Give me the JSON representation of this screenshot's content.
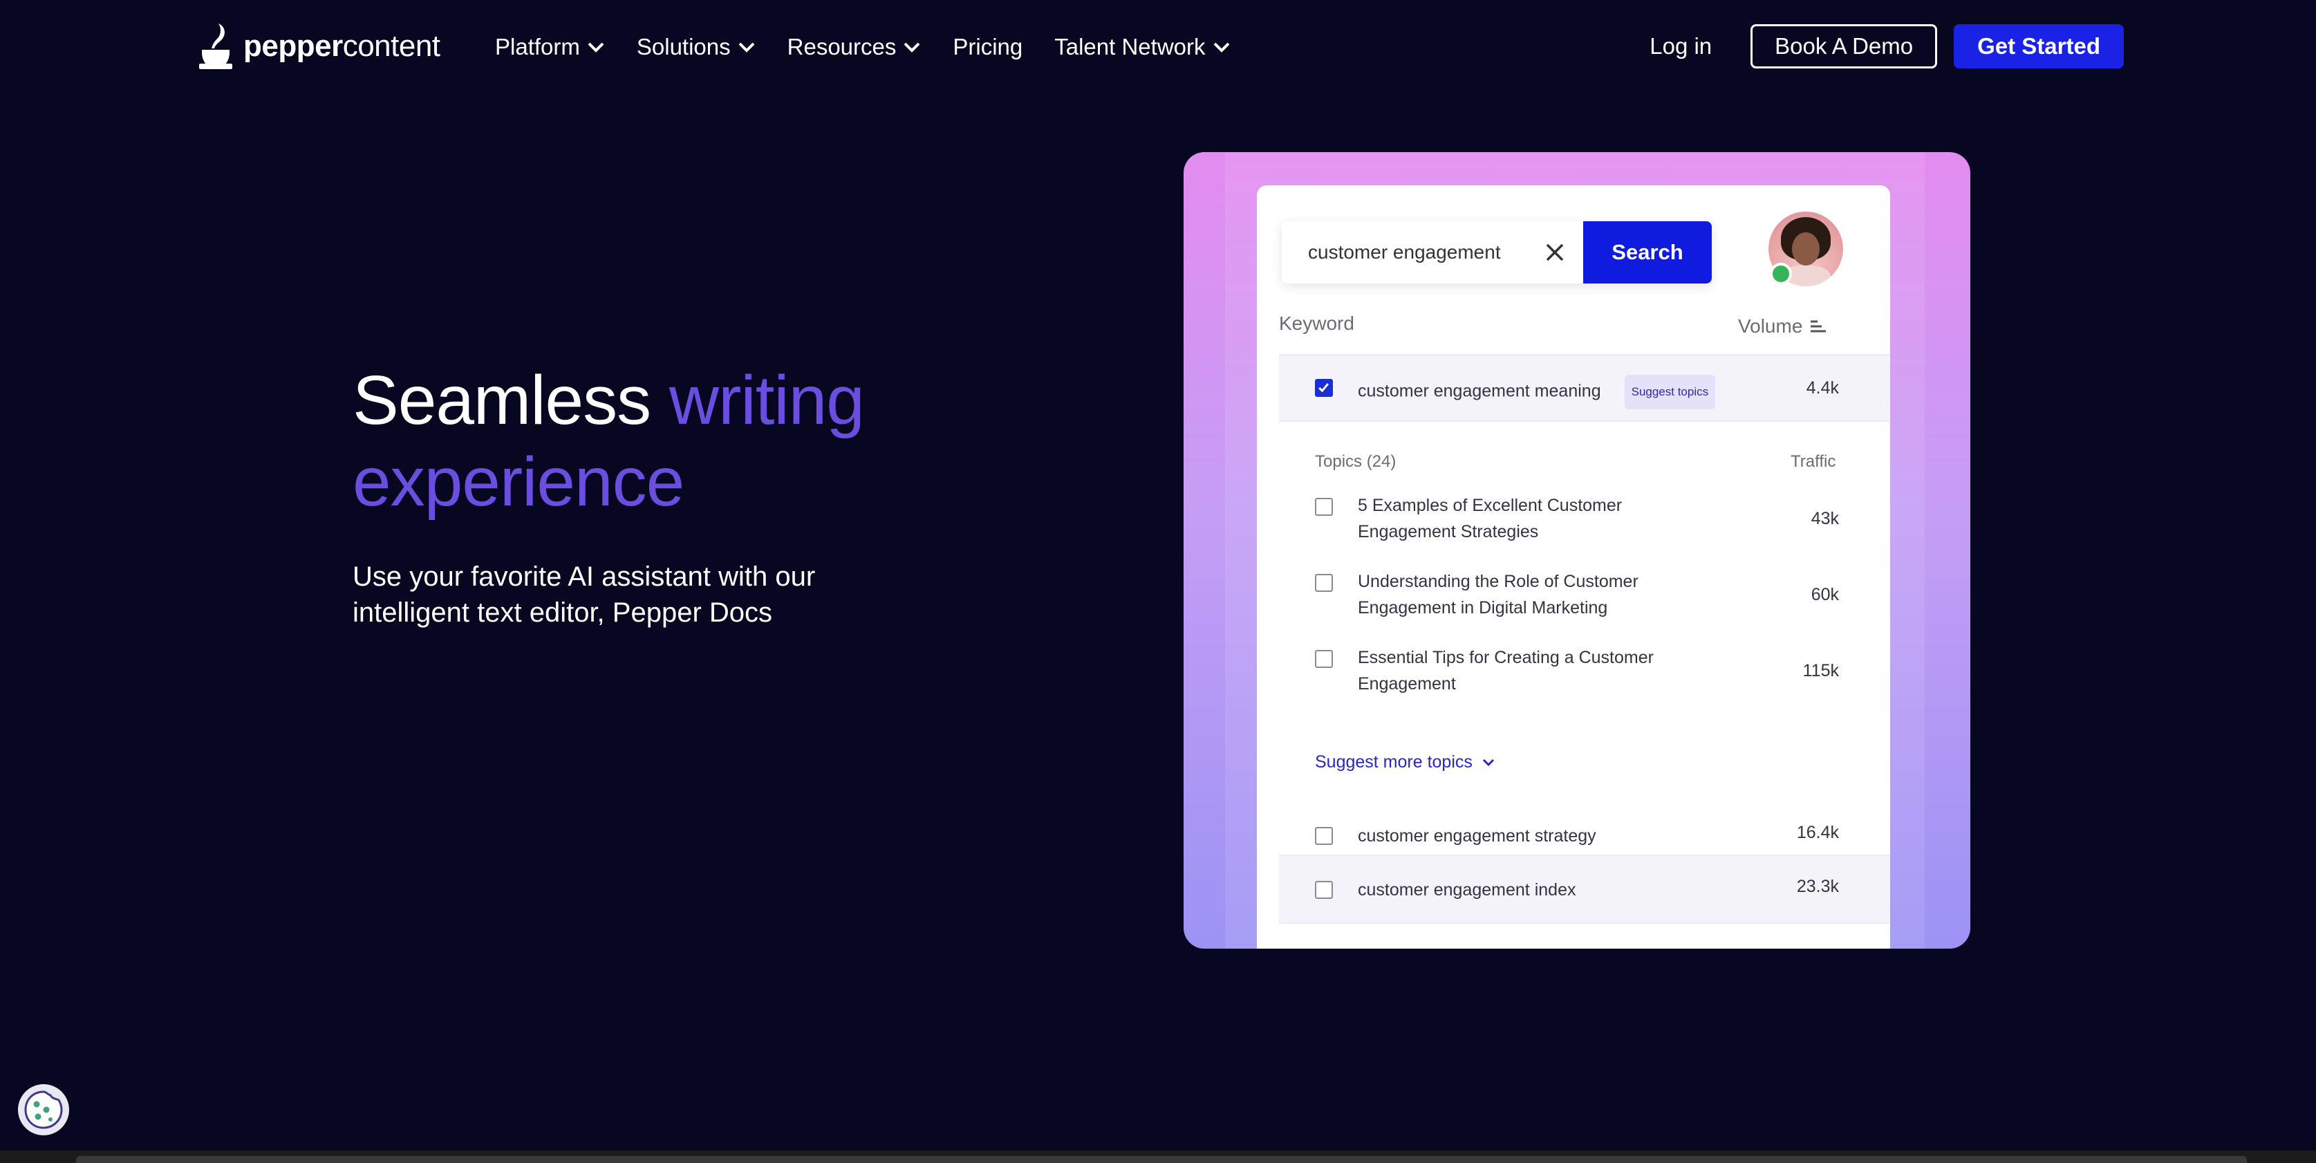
{
  "brand": {
    "name_bold": "pepper",
    "name_light": "content"
  },
  "nav": {
    "items": [
      {
        "label": "Platform",
        "dropdown": true
      },
      {
        "label": "Solutions",
        "dropdown": true
      },
      {
        "label": "Resources",
        "dropdown": true
      },
      {
        "label": "Pricing",
        "dropdown": false
      },
      {
        "label": "Talent Network",
        "dropdown": true
      }
    ],
    "login_label": "Log in",
    "demo_label": "Book A Demo",
    "start_label": "Get Started"
  },
  "hero": {
    "title_plain": "Seamless ",
    "title_accent_1": "writing",
    "title_accent_2": "experience",
    "subtitle": "Use your favorite AI assistant with our intelligent text editor, Pepper Docs"
  },
  "card": {
    "search": {
      "value": "customer engagement",
      "button_label": "Search"
    },
    "columns": {
      "keyword": "Keyword",
      "volume": "Volume"
    },
    "selected_keyword": {
      "label": "customer engagement meaning",
      "tag": "Suggest topics",
      "volume": "4.4k",
      "checked": true
    },
    "topics_header": {
      "title": "Topics (24)",
      "traffic": "Traffic"
    },
    "topics": [
      {
        "line1": "5 Examples of Excellent Customer",
        "line2": "Engagement Strategies",
        "traffic": "43k"
      },
      {
        "line1": "Understanding the Role of Customer",
        "line2": "Engagement in Digital Marketing",
        "traffic": "60k"
      },
      {
        "line1": "Essential Tips for Creating a Customer",
        "line2": "Engagement",
        "traffic": "115k"
      }
    ],
    "suggest_more_label": "Suggest more topics",
    "keywords": [
      {
        "label": "customer engagement strategy",
        "volume": "16.4k"
      },
      {
        "label": "customer engagement index",
        "volume": "23.3k"
      }
    ]
  },
  "colors": {
    "background": "#070721",
    "accent": "#6a4ee0",
    "primary_button": "#1a22e6"
  }
}
